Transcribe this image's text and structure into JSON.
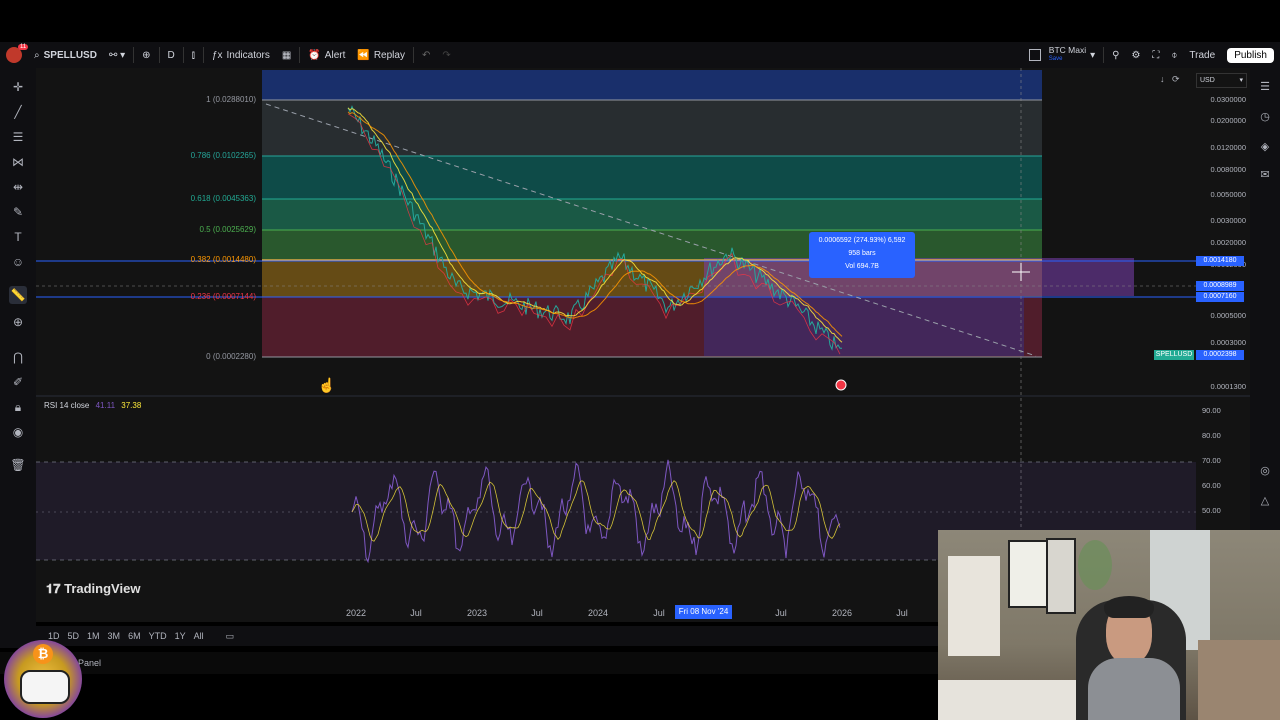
{
  "toolbar": {
    "symbol": "SPELLUSD",
    "interval": "D",
    "indicators_label": "Indicators",
    "alert_label": "Alert",
    "replay_label": "Replay",
    "layout_name": "BTC Maxi",
    "layout_sub": "Save",
    "trade_label": "Trade",
    "publish_label": "Publish",
    "notif_count": "11"
  },
  "price_axis": {
    "currency": "USD",
    "ticks": [
      "0.0300000",
      "0.0200000",
      "0.0120000",
      "0.0080000",
      "0.0050000",
      "0.0030000",
      "0.0020000",
      "0.0012000",
      "0.0005000",
      "0.0003000",
      "0.0001300"
    ],
    "labels": {
      "top_blue": "0.0014180",
      "mid_blue1": "0.0008989",
      "mid_blue2": "0.0007160",
      "symbol_tag": "SPELLUSD",
      "symbol_price": "0.0002398"
    }
  },
  "fib_levels": [
    {
      "text": "1 (0.0288010)",
      "color": "#9598a1"
    },
    {
      "text": "0.786 (0.0102265)",
      "color": "#26a69a"
    },
    {
      "text": "0.618 (0.0045363)",
      "color": "#22ab94"
    },
    {
      "text": "0.5 (0.0025629)",
      "color": "#4caf50"
    },
    {
      "text": "0.382 (0.0014480)",
      "color": "#ff9800"
    },
    {
      "text": "0.236 (0.0007144)",
      "color": "#f23645"
    },
    {
      "text": "0 (0.0002280)",
      "color": "#9598a1"
    }
  ],
  "measure_tooltip": {
    "line1": "0.0006592 (274.93%) 6,592",
    "line2": "958 bars",
    "line3": "Vol 694.7B"
  },
  "rsi": {
    "label": "RSI 14 close",
    "value1": "41.11",
    "value2": "37.38",
    "ticks": [
      "90.00",
      "80.00",
      "70.00",
      "60.00",
      "50.00"
    ]
  },
  "time_axis": {
    "ticks": [
      "2022",
      "Jul",
      "2023",
      "Jul",
      "2024",
      "Jul",
      "Jul",
      "2026",
      "Jul"
    ],
    "crosshair_date": "Fri 08 Nov '24"
  },
  "watermark": "TradingView",
  "bottom_toolbar": {
    "ranges": [
      "1D",
      "5D",
      "1M",
      "3M",
      "6M",
      "YTD",
      "1Y",
      "All"
    ]
  },
  "panel_label": "Panel",
  "colors": {
    "background": "#131313",
    "accent_blue": "#2962ff",
    "rsi_line": "#7e57c2",
    "rsi_ma": "#ffeb3b"
  }
}
